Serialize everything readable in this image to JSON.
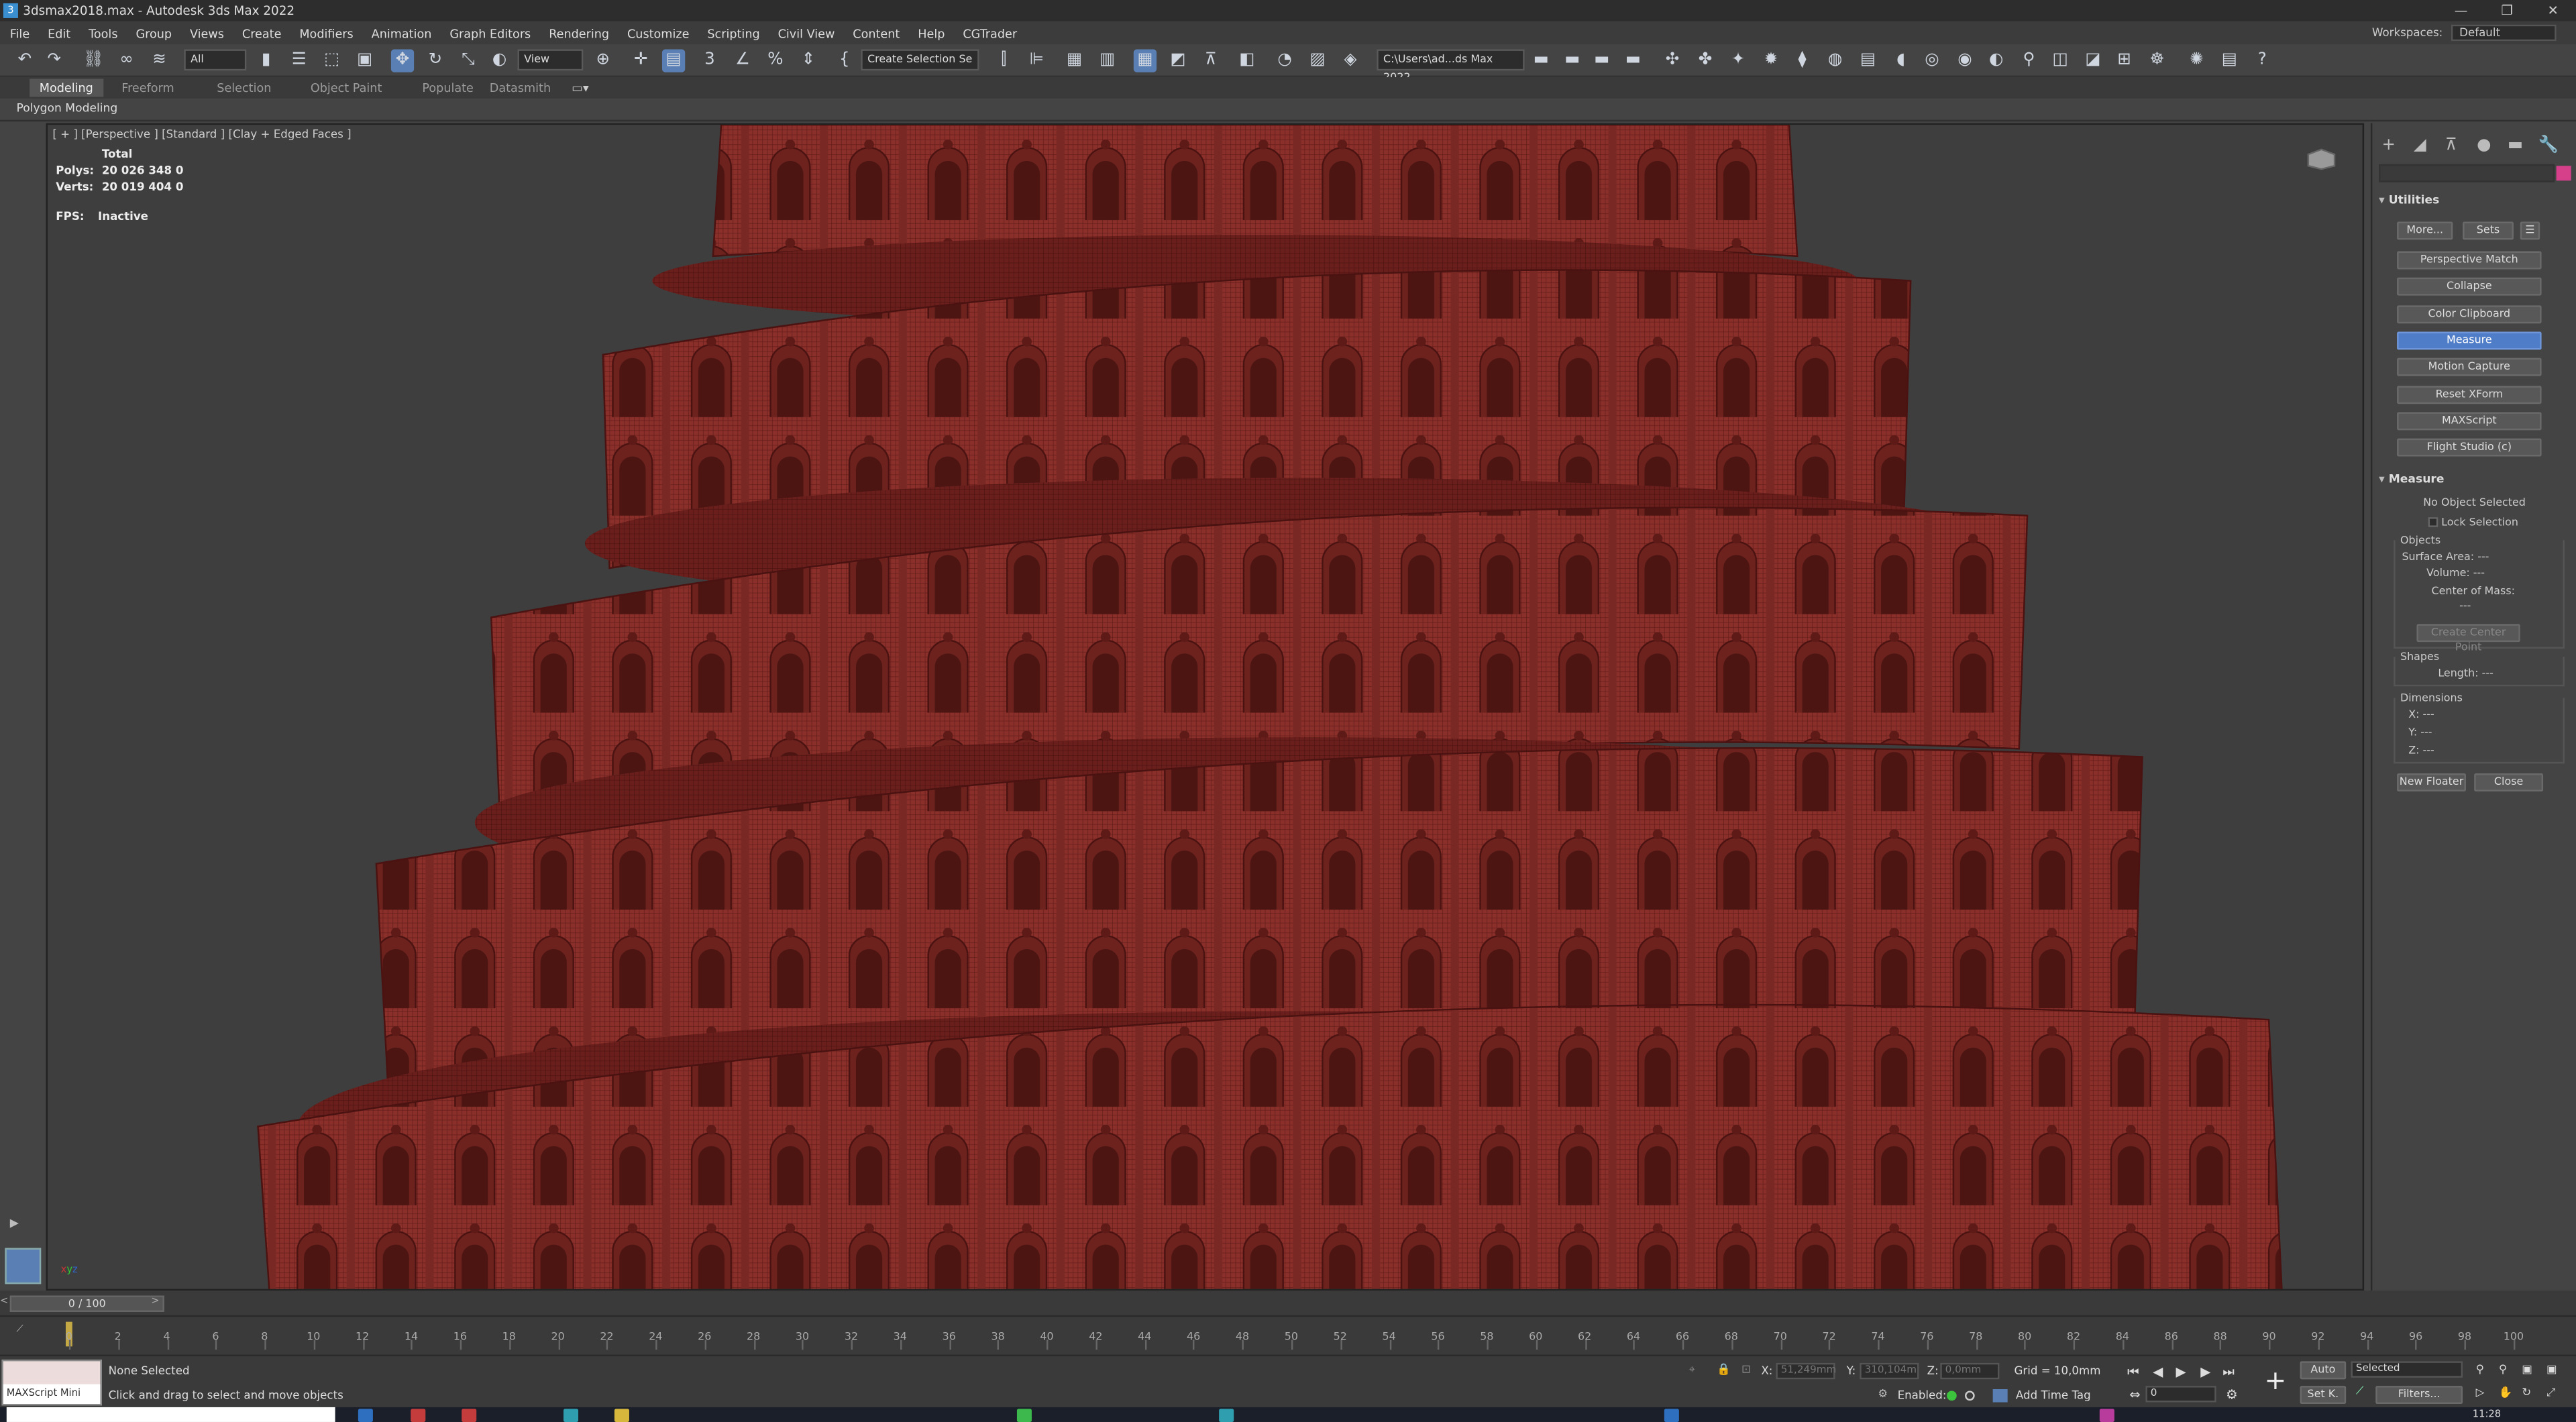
{
  "window": {
    "title": "3dsmax2018.max - Autodesk 3ds Max 2022",
    "app_icon": "3ds-max-icon",
    "controls": [
      "minimize-icon",
      "restore-icon",
      "close-icon"
    ]
  },
  "menu": [
    "File",
    "Edit",
    "Tools",
    "Group",
    "Views",
    "Create",
    "Modifiers",
    "Animation",
    "Graph Editors",
    "Rendering",
    "Customize",
    "Scripting",
    "Civil View",
    "Content",
    "Help",
    "CGTrader"
  ],
  "workspace": {
    "label": "Workspaces:",
    "value": "Default"
  },
  "toolbar": {
    "selection_filter": "All",
    "reference_coord": "View",
    "named_selection": "Create Selection Se",
    "project_path": "C:\\Users\\ad...ds Max 2022"
  },
  "ribbon": {
    "tabs": [
      "Modeling",
      "Freeform",
      "Selection",
      "Object Paint",
      "Populate",
      "Datasmith"
    ],
    "active_tab": "Modeling",
    "panel_label": "Polygon Modeling"
  },
  "viewport": {
    "label": "[ + ] [Perspective ] [Standard ] [Clay + Edged Faces ]",
    "stats_header": "Total",
    "polys_label": "Polys:",
    "polys_value": "20 026 348 0",
    "verts_label": "Verts:",
    "verts_value": "20 019 404 0",
    "fps_label": "FPS:",
    "fps_value": "Inactive",
    "model_color": "#8a2f2a",
    "background_color": "#3e3e3e"
  },
  "command_panel": {
    "utilities_title": "Utilities",
    "more_button": "More...",
    "sets_button": "Sets",
    "utility_buttons": [
      "Perspective Match",
      "Collapse",
      "Color Clipboard",
      "Measure",
      "Motion Capture",
      "Reset XForm",
      "MAXScript",
      "Flight Studio (c)"
    ],
    "active_utility": "Measure",
    "measure": {
      "title": "Measure",
      "status": "No Object Selected",
      "lock_selection": "Lock Selection",
      "objects_label": "Objects",
      "surface_area": "Surface Area:  ---",
      "volume": "Volume:  ---",
      "center_of_mass": "Center of Mass:",
      "center_value": "---",
      "create_center_point": "Create Center Point",
      "shapes_label": "Shapes",
      "length": "Length:  ---",
      "dimensions_label": "Dimensions",
      "x": "X:  ---",
      "y": "Y:  ---",
      "z": "Z:  ---",
      "new_floater": "New Floater",
      "close": "Close"
    },
    "highlight_color": "#4f7dc8"
  },
  "timeline": {
    "slider_label": "0 / 100",
    "ticks": [
      "0",
      "2",
      "4",
      "6",
      "8",
      "10",
      "12",
      "14",
      "16",
      "18",
      "20",
      "22",
      "24",
      "26",
      "28",
      "30",
      "32",
      "34",
      "36",
      "38",
      "40",
      "42",
      "44",
      "46",
      "48",
      "50",
      "52",
      "54",
      "56",
      "58",
      "60",
      "62",
      "64",
      "66",
      "68",
      "70",
      "72",
      "74",
      "76",
      "78",
      "80",
      "82",
      "84",
      "86",
      "88",
      "90",
      "92",
      "94",
      "96",
      "98",
      "100"
    ],
    "current_frame": 0
  },
  "status": {
    "maxscript": "MAXScript Mini",
    "selection": "None Selected",
    "prompt": "Click and drag to select and move objects",
    "x_label": "X:",
    "x_value": "51,249mm",
    "y_label": "Y:",
    "y_value": "310,104m",
    "z_label": "Z:",
    "z_value": "0,0mm",
    "grid": "Grid = 10,0mm",
    "enabled": "Enabled:",
    "add_time_tag": "Add Time Tag",
    "auto": "Auto",
    "set_key": "Set K.",
    "selected_dd": "Selected",
    "filters": "Filters...",
    "frame_value": "0",
    "clock": "11:28"
  }
}
